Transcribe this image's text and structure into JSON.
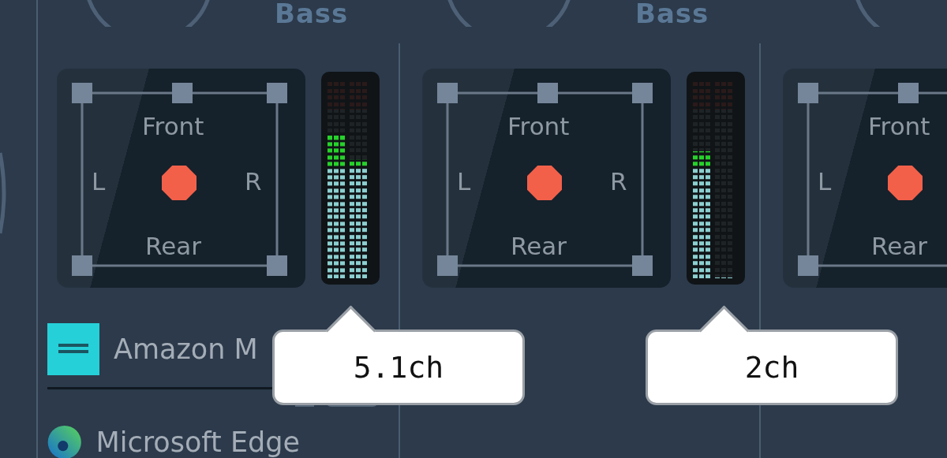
{
  "strips": [
    {
      "knob_label": "Bass",
      "panner": {
        "front": "Front",
        "left": "L",
        "right": "R",
        "rear": "Rear"
      },
      "meter": {
        "channels": [
          {
            "level": 0.72
          },
          {
            "level": 0.6
          }
        ]
      },
      "tooltip": "5.1ch",
      "apps": [
        {
          "kind": "music",
          "name": "Amazon M"
        },
        {
          "kind": "browser",
          "name": "Microsoft Edge"
        }
      ]
    },
    {
      "knob_label": "Bass",
      "panner": {
        "front": "Front",
        "left": "L",
        "right": "R",
        "rear": "Rear"
      },
      "meter": {
        "channels": [
          {
            "level": 0.64
          },
          {
            "level": 0
          }
        ]
      },
      "tooltip": "2ch"
    },
    {
      "panner": {
        "front": "Front",
        "left": "L",
        "rear": "Rear"
      }
    }
  ]
}
